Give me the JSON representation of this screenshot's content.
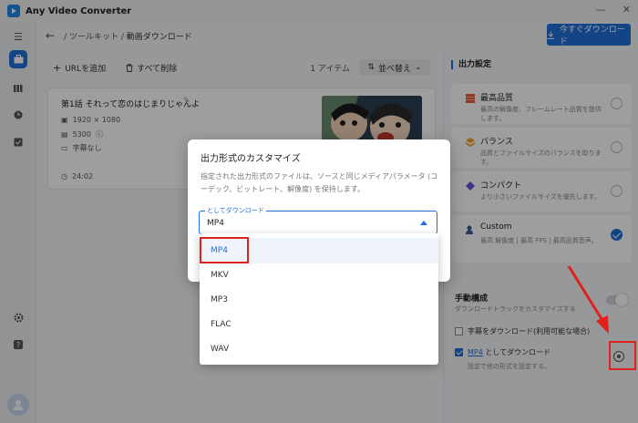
{
  "app": {
    "title": "Any Video Converter"
  },
  "header": {
    "breadcrumb_root": "ツールキット",
    "breadcrumb_sep": "/",
    "breadcrumb_current": "動画ダウンロード",
    "download_now": "今すぐダウンロード"
  },
  "toolbar": {
    "add_url": "URLを追加",
    "delete_all": "すべて削除",
    "item_count": "1 アイテム",
    "sort": "並べ替え"
  },
  "video": {
    "title": "第1話 それって恋のはじまりじゃんよ",
    "resolution": "1920 × 1080",
    "bitrate": "5300",
    "subtitle": "字幕なし",
    "duration": "24:02"
  },
  "panel": {
    "title": "出力設定",
    "qualities": [
      {
        "title": "最高品質",
        "desc": "最高の解像度、フレームレート品質を提供します。",
        "color": "#e85a3c",
        "selected": false
      },
      {
        "title": "バランス",
        "desc": "品質とファイルサイズのバランスを取ります。",
        "color": "#f2a31b",
        "selected": false
      },
      {
        "title": "コンパクト",
        "desc": "より小さいファイルサイズを優先します。",
        "color": "#6a4fd6",
        "selected": false
      },
      {
        "title": "Custom",
        "desc": "最高 解像度 | 最高 FPS | 最高品質音声。",
        "color": "#3a5a8c",
        "selected": true
      }
    ],
    "manual_title": "手動構成",
    "manual_desc": "ダウンロードトラックをカスタマイズする",
    "subtitle_download": "字幕をダウンロード(利用可能な場合)",
    "format_link": "MP4",
    "format_suffix": " としてダウンロード",
    "format_desc": "設定で他の形式を設定する。"
  },
  "dialog": {
    "title": "出力形式のカスタマイズ",
    "desc": "指定された出力形式のファイルは、ソースと同じメディアパラメータ (コーデック、ビットレート、解像度) を保持します。",
    "select_label": "としてダウンロード",
    "select_value": "MP4",
    "options": [
      "MP4",
      "MKV",
      "MP3",
      "FLAC",
      "WAV"
    ]
  },
  "colors": {
    "accent": "#1e6fd9",
    "annotation": "#e0211d"
  }
}
